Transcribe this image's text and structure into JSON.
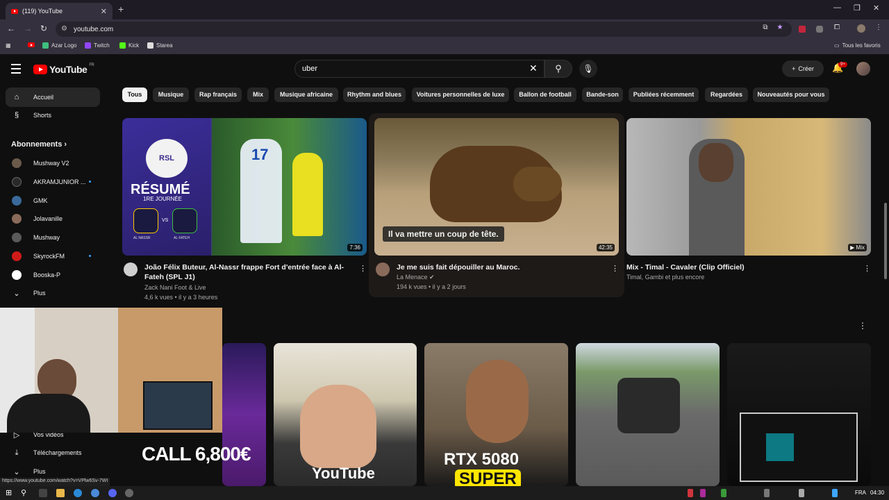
{
  "browser": {
    "tab_title": "(119) YouTube",
    "url": "youtube.com",
    "bookmarks": [
      "Azar Logo",
      "Twitch",
      "Kick",
      "Starea"
    ],
    "all_bookmarks_label": "Tous les favoris",
    "status_url": "https://www.youtube.com/watch?v=VPlw6Sv-7WI"
  },
  "header": {
    "logo_text": "YouTube",
    "logo_region": "FR",
    "search_value": "uber",
    "create_label": "Créer",
    "notif_badge": "9+"
  },
  "chips": [
    "Tous",
    "Musique",
    "Rap français",
    "Mix",
    "Musique africaine",
    "Rhythm and blues",
    "Voitures personnelles de luxe",
    "Ballon de football",
    "Bande-son",
    "Publiées récemment",
    "Regardées",
    "Nouveautés pour vous"
  ],
  "sidebar": {
    "home": "Accueil",
    "shorts": "Shorts",
    "subscriptions_title": "Abonnements",
    "subscriptions": [
      {
        "name": "Mushway V2",
        "color": "#6a5a4a",
        "new": false
      },
      {
        "name": "AKRAMJUNIOR ...",
        "color": "#2a2a2a",
        "new": true
      },
      {
        "name": "GMK",
        "color": "#3a6a9a",
        "new": false
      },
      {
        "name": "Jolavanille",
        "color": "#8a6a5a",
        "new": false
      },
      {
        "name": "Mushway",
        "color": "#5a5a5a",
        "new": false
      },
      {
        "name": "SkyrockFM",
        "color": "#d01a1a",
        "new": true
      },
      {
        "name": "Booska-P",
        "color": "#ffffff",
        "new": false
      }
    ],
    "more": "Plus",
    "your_videos": "Vos vidéos",
    "downloads": "Téléchargements",
    "more2": "Plus"
  },
  "videos": [
    {
      "title": "João Félix Buteur, Al-Nassr frappe Fort d'entrée face à Al-Fateh (SPL J1)",
      "channel": "Zack Nani Foot & Live",
      "stats": "4,6 k vues • il y a 3 heures",
      "duration": "7:36",
      "thumb_text": {
        "badge": "RSL",
        "title": "RÉSUMÉ",
        "subtitle": "1RE JOURNÉE",
        "vs": "VS",
        "team1": "AL NASSR",
        "team2": "AL FATEH",
        "jersey": "17"
      }
    },
    {
      "title": "Je me suis fait dépouiller au Maroc.",
      "channel": "La Menace",
      "verified": true,
      "stats": "194 k vues • il y a 2 jours",
      "duration": "42:35",
      "caption": "Il va mettre un coup de tête."
    },
    {
      "title": "Mix - Timal - Cavaler (Clip Officiel)",
      "channel": "Timal, Gambi et plus encore",
      "mix_label": "Mix"
    }
  ],
  "shorts_row": {
    "thumb_texts": [
      "CALL 6,800€",
      "YouTube",
      "RTX 5080",
      "SUPER"
    ]
  },
  "taskbar": {
    "lang": "FRA",
    "time": "04:30"
  },
  "icons": [
    "home-icon",
    "shorts-icon",
    "chevron-right-icon",
    "chevron-down-icon",
    "search-icon",
    "mic-icon",
    "bell-icon",
    "plus-icon",
    "close-icon",
    "kebab-icon",
    "verified-icon",
    "download-icon",
    "menu-icon",
    "star-icon"
  ],
  "colors": {
    "accent": "#ff0000",
    "background": "#0f0f0f",
    "chip": "#272727",
    "new_dot": "#3ea6ff"
  }
}
